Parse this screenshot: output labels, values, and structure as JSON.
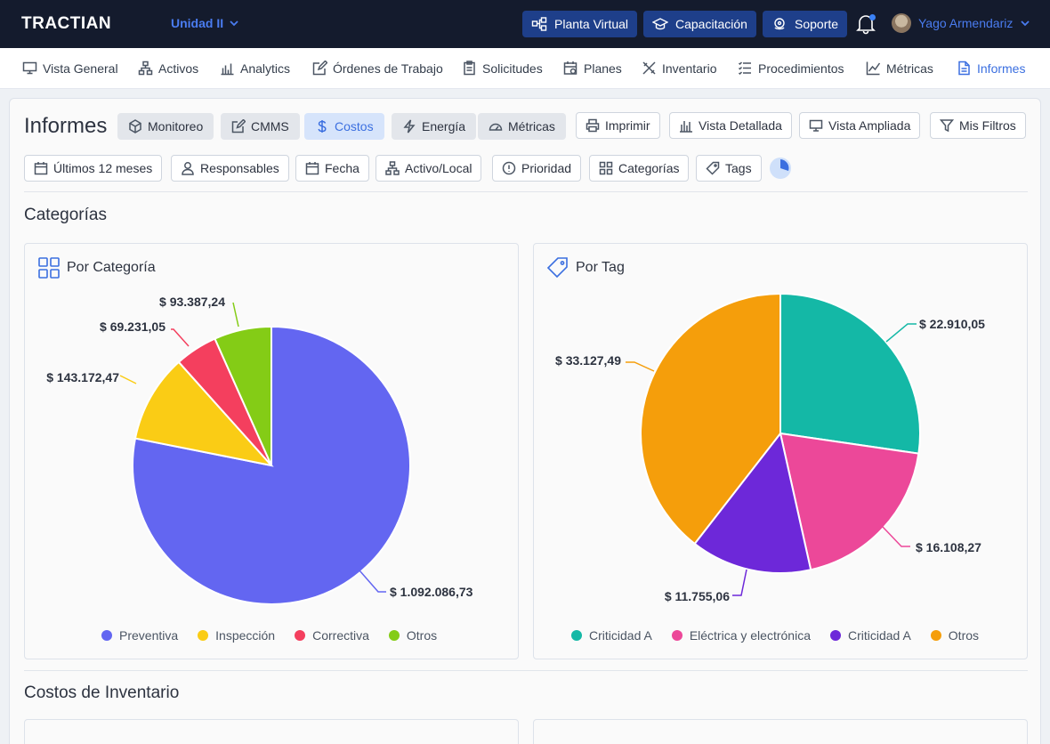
{
  "app": {
    "logo": "TRACTIAN",
    "unit": "Unidad II",
    "buttons": [
      "Planta Virtual",
      "Capacitación",
      "Soporte"
    ],
    "user": "Yago Armendariz"
  },
  "nav": [
    "Vista General",
    "Activos",
    "Analytics",
    "Órdenes de Trabajo",
    "Solicitudes",
    "Planes",
    "Inventario",
    "Procedimientos",
    "Métricas",
    "Informes"
  ],
  "page": {
    "title": "Informes",
    "tabs": [
      "Monitoreo",
      "CMMS",
      "Costos",
      "Energía",
      "Métricas"
    ],
    "active_tab": "Costos",
    "actions": [
      "Imprimir",
      "Vista Detallada",
      "Vista Ampliada",
      "Mis Filtros"
    ],
    "filters": [
      "Últimos 12 meses",
      "Responsables",
      "Fecha",
      "Activo/Local",
      "Prioridad",
      "Categorías",
      "Tags"
    ],
    "section1": "Categorías",
    "section2": "Costos de Inventario"
  },
  "chart_data": [
    {
      "type": "pie",
      "title": "Por Categoría",
      "categories": [
        "Preventiva",
        "Inspección",
        "Correctiva",
        "Otros"
      ],
      "values": [
        1092086.73,
        143172.47,
        69231.05,
        93387.24
      ],
      "labels": [
        "$ 1.092.086,73",
        "$ 143.172,47",
        "$ 69.231,05",
        "$ 93.387,24"
      ],
      "colors": [
        "#6366f1",
        "#facc15",
        "#f43f5e",
        "#84cc16"
      ]
    },
    {
      "type": "pie",
      "title": "Por Tag",
      "categories": [
        "Criticidad A",
        "Eléctrica y electrónica",
        "Criticidad A",
        "Otros"
      ],
      "values": [
        22910.05,
        16108.27,
        11755.06,
        33127.49
      ],
      "labels": [
        "$ 22.910,05",
        "$ 16.108,27",
        "$ 11.755,06",
        "$ 33.127,49"
      ],
      "colors": [
        "#14b8a6",
        "#ec4899",
        "#6d28d9",
        "#f59e0b"
      ]
    }
  ]
}
